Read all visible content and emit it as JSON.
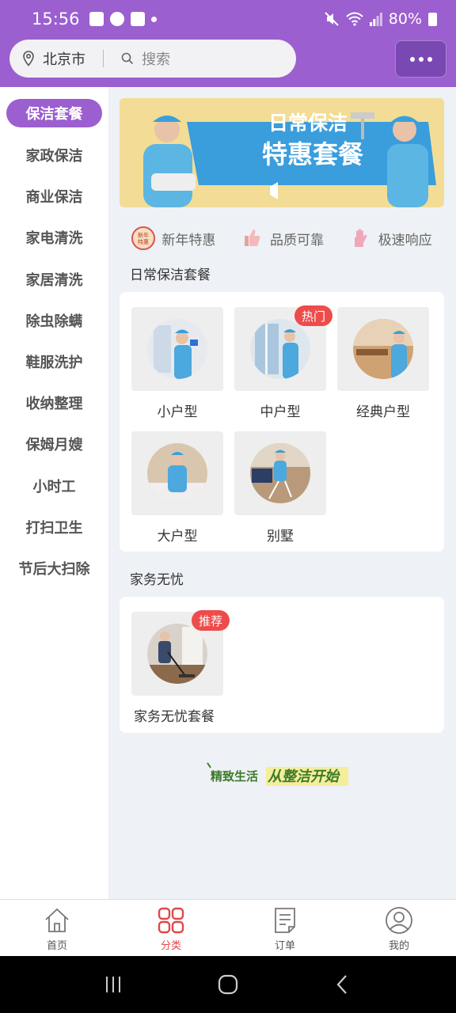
{
  "status_bar": {
    "time": "15:56",
    "battery": "80%"
  },
  "header": {
    "location": "北京市",
    "search_placeholder": "搜索"
  },
  "sidebar": {
    "items": [
      {
        "label": "保洁套餐",
        "active": true
      },
      {
        "label": "家政保洁"
      },
      {
        "label": "商业保洁"
      },
      {
        "label": "家电清洗"
      },
      {
        "label": "家居清洗"
      },
      {
        "label": "除虫除螨"
      },
      {
        "label": "鞋服洗护"
      },
      {
        "label": "收纳整理"
      },
      {
        "label": "保姆月嫂"
      },
      {
        "label": "小时工"
      },
      {
        "label": "打扫卫生"
      },
      {
        "label": "节后大扫除"
      }
    ]
  },
  "banner": {
    "line1": "日常保洁",
    "line2": "特惠套餐"
  },
  "features": [
    {
      "icon": "new-year-badge-icon",
      "icon_text": "新年特惠",
      "label": "新年特惠"
    },
    {
      "icon": "thumbs-up-icon",
      "label": "品质可靠"
    },
    {
      "icon": "glove-icon",
      "label": "极速响应"
    }
  ],
  "sections": [
    {
      "title": "日常保洁套餐",
      "items": [
        {
          "label": "小户型"
        },
        {
          "label": "中户型",
          "badge": "热门"
        },
        {
          "label": "经典户型"
        },
        {
          "label": "大户型"
        },
        {
          "label": "别墅"
        }
      ]
    },
    {
      "title": "家务无忧",
      "items": [
        {
          "label": "家务无忧套餐",
          "badge": "推荐"
        }
      ]
    }
  ],
  "slogan": {
    "part1": "精致生活",
    "part2": "从整洁开始"
  },
  "tab_bar": {
    "tabs": [
      {
        "label": "首页",
        "icon": "home-icon"
      },
      {
        "label": "分类",
        "icon": "category-grid-icon",
        "active": true
      },
      {
        "label": "订单",
        "icon": "order-icon"
      },
      {
        "label": "我的",
        "icon": "profile-icon"
      }
    ]
  },
  "colors": {
    "primary": "#9b5fd0",
    "accent_red": "#e04848",
    "badge_red": "#ee4b4b"
  }
}
